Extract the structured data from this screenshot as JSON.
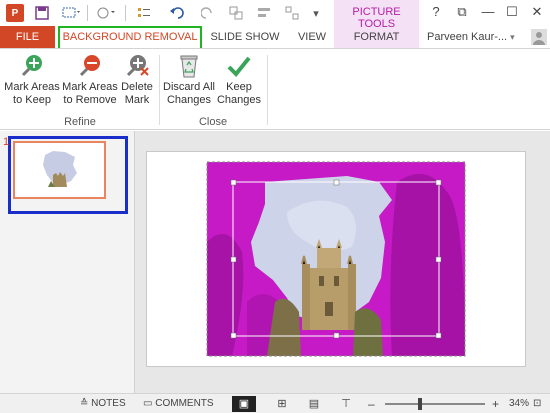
{
  "titlebar": {
    "app_icon": "powerpoint-icon",
    "qat_icons": [
      "save-icon",
      "selection-icon",
      "shape-icon",
      "bullets-icon",
      "undo-icon",
      "redo-icon",
      "group-icon",
      "align-icon",
      "more-icon"
    ],
    "contextual_label": "PICTURE TOOLS",
    "window_controls": [
      "?",
      "⧉",
      "—",
      "☐",
      "✕"
    ]
  },
  "tabs": {
    "file": "FILE",
    "items": [
      {
        "label": "BACKGROUND REMOVAL",
        "active": true
      },
      {
        "label": "SLIDE SHOW",
        "active": false
      },
      {
        "label": "VIEW",
        "active": false
      },
      {
        "label": "FORMAT",
        "active": false
      }
    ],
    "user": "Parveen Kaur-..."
  },
  "ribbon": {
    "refine": {
      "label": "Refine",
      "buttons": [
        {
          "line1": "Mark Areas",
          "line2": "to Keep",
          "icon": "mark-keep-icon"
        },
        {
          "line1": "Mark Areas",
          "line2": "to Remove",
          "icon": "mark-remove-icon"
        },
        {
          "line1": "Delete",
          "line2": "Mark",
          "icon": "delete-mark-icon"
        }
      ]
    },
    "close": {
      "label": "Close",
      "buttons": [
        {
          "line1": "Discard All",
          "line2": "Changes",
          "icon": "recycle-bin-icon"
        },
        {
          "line1": "Keep",
          "line2": "Changes",
          "icon": "checkmark-icon"
        }
      ]
    }
  },
  "thumbnails": {
    "slide_number": "1"
  },
  "statusbar": {
    "notes": "NOTES",
    "comments": "COMMENTS",
    "zoom": "34%"
  },
  "colors": {
    "accent": "#d24726",
    "removal_magenta": "#c51ac5",
    "highlight_green": "#21b421",
    "highlight_blue": "#1a2fc9"
  }
}
